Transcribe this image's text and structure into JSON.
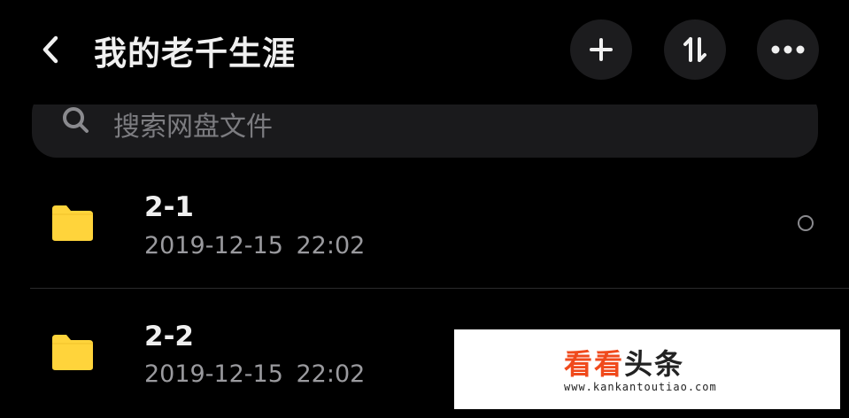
{
  "header": {
    "title": "我的老千生涯",
    "back_icon": "chevron-left-icon",
    "actions": [
      {
        "id": "add",
        "icon": "plus-icon"
      },
      {
        "id": "sort",
        "icon": "sort-icon"
      },
      {
        "id": "more",
        "icon": "more-horizontal-icon"
      }
    ]
  },
  "search": {
    "placeholder": "搜索网盘文件",
    "icon": "search-icon"
  },
  "files": [
    {
      "name": "2-1",
      "date": "2019-12-15 22:02",
      "icon": "folder-icon"
    },
    {
      "name": "2-2",
      "date": "2019-12-15 22:02",
      "icon": "folder-icon"
    }
  ],
  "watermark": {
    "brand_part1": "看看",
    "brand_part2": "头条",
    "url": "www.kankantoutiao.com"
  },
  "colors": {
    "background": "#000000",
    "folder": "#FFD43B",
    "button_bg": "#1C1C1E",
    "secondary_text": "#9A9A9E",
    "watermark_accent": "#F04A1C"
  }
}
